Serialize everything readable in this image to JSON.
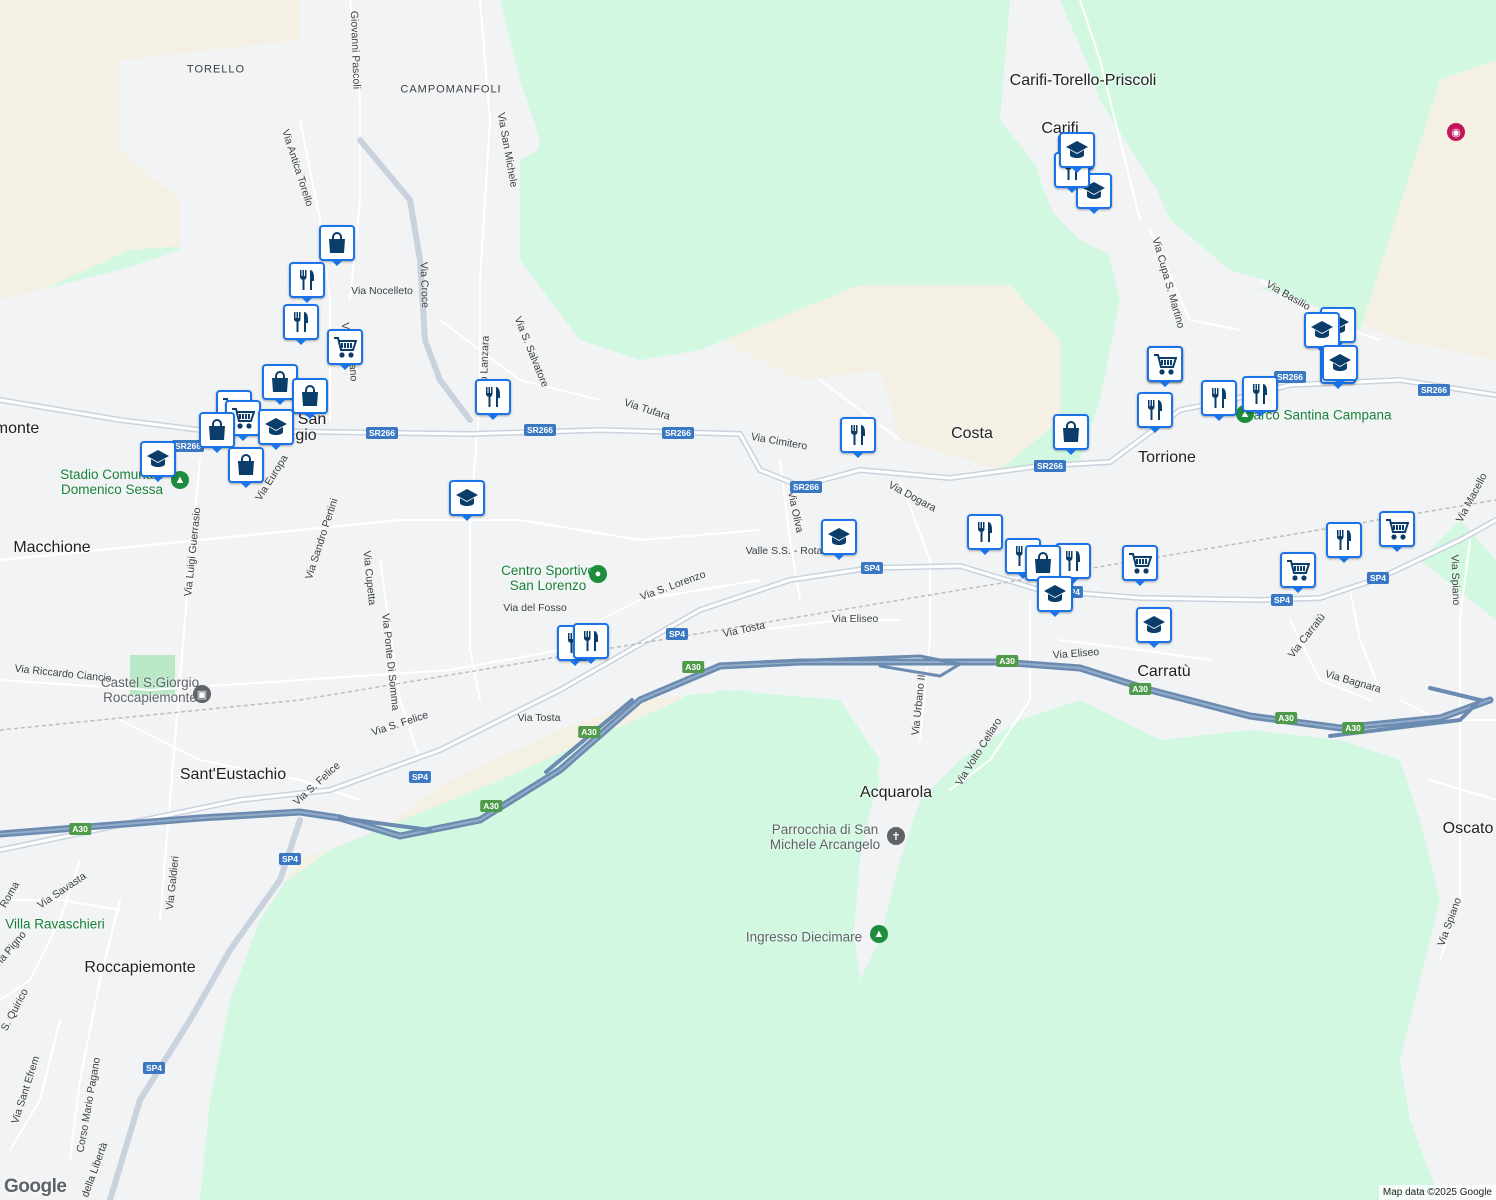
{
  "map": {
    "attribution": "Map data ©2025 Google",
    "brand": "Google",
    "places": [
      {
        "name": "TORELLO",
        "cls": "hamlet"
      },
      {
        "name": "CAMPOMANFOLI",
        "cls": "hamlet"
      },
      {
        "name": "Carifi-Torello-Priscoli",
        "cls": "place"
      },
      {
        "name": "Carifi",
        "cls": "place"
      },
      {
        "name": "Costa",
        "cls": "place"
      },
      {
        "name": "Torrione",
        "cls": "place"
      },
      {
        "name": "monte",
        "cls": "place"
      },
      {
        "name": "Macchione",
        "cls": "place"
      },
      {
        "name": "Carratù",
        "cls": "place"
      },
      {
        "name": "Acquarola",
        "cls": "place"
      },
      {
        "name": "Sant'Eustachio",
        "cls": "place"
      },
      {
        "name": "Oscato",
        "cls": "place"
      },
      {
        "name": "Roccapiemonte",
        "cls": "place"
      },
      {
        "name": "San",
        "cls": "place"
      },
      {
        "name": "gio",
        "cls": "place"
      }
    ],
    "streets": [
      "Giovanni Pascoli",
      "Via Antica Torello",
      "Via San Michele",
      "Via Croce",
      "Via Nocelleto",
      "Via S. Salvatore",
      "Via Tufara",
      "Via Cimitero",
      "Via Dogara",
      "Via Oliva",
      "Valle S.S. - Rota",
      "Via S. Lorenzo",
      "Via del Fosso",
      "Via Tosta",
      "Via Eliseo",
      "Via Eliseo",
      "Via Urbano II",
      "Via Volto Cellaro",
      "Via Cupa S. Martino",
      "Via Basilio",
      "Via Macello",
      "Via Spiano",
      "Via Carratù",
      "Via Bagnara",
      "Via Sandro Pertini",
      "Via Luigi Guerrasio",
      "Via Europa",
      "Via Cupetta",
      "Via Ponte Di Somma",
      "Via Riccardo Ciancio",
      "Via S. Felice",
      "Via Tosta",
      "Via S. Felice",
      "Via Galdieri",
      "Via Savasta",
      "Roma",
      "Via Pigno",
      "S. Quirico",
      "Via Sant Efrem",
      "Corso Mario Pagano",
      "della Libertà",
      "Via Spiano",
      "Capuano",
      "Via",
      "do Lanzara"
    ],
    "shields": [
      {
        "text": "SR266",
        "kind": "blue"
      },
      {
        "text": "SR266",
        "kind": "blue"
      },
      {
        "text": "SR266",
        "kind": "blue"
      },
      {
        "text": "SR266",
        "kind": "blue"
      },
      {
        "text": "SR266",
        "kind": "blue"
      },
      {
        "text": "SR266",
        "kind": "blue"
      },
      {
        "text": "SR266",
        "kind": "blue"
      },
      {
        "text": "SR266",
        "kind": "blue"
      },
      {
        "text": "SP4",
        "kind": "blue"
      },
      {
        "text": "SP4",
        "kind": "blue"
      },
      {
        "text": "SP4",
        "kind": "blue"
      },
      {
        "text": "SP4",
        "kind": "blue"
      },
      {
        "text": "SP4",
        "kind": "blue"
      },
      {
        "text": "SP4",
        "kind": "blue"
      },
      {
        "text": "SP4",
        "kind": "blue"
      },
      {
        "text": "SP4",
        "kind": "blue"
      },
      {
        "text": "A30",
        "kind": "green"
      },
      {
        "text": "A30",
        "kind": "green"
      },
      {
        "text": "A30",
        "kind": "green"
      },
      {
        "text": "A30",
        "kind": "green"
      },
      {
        "text": "A30",
        "kind": "green"
      },
      {
        "text": "A30",
        "kind": "green"
      },
      {
        "text": "A30",
        "kind": "green"
      },
      {
        "text": "A30",
        "kind": "green"
      }
    ],
    "pois": [
      {
        "name": "Stadio Comunale\nDomenico Sessa",
        "cls": "poi-green",
        "icon": "stadium-icon"
      },
      {
        "name": "Centro Sportivo\nSan Lorenzo",
        "cls": "poi-green",
        "icon": "sports-center-icon"
      },
      {
        "name": "Parco Santina Campana",
        "cls": "poi-green",
        "icon": "park-icon"
      },
      {
        "name": "Castel S.Giorgio\nRoccapiemonte",
        "cls": "poi-gray",
        "icon": "train-station-icon"
      },
      {
        "name": "Parrocchia di San\nMichele Arcangelo",
        "cls": "poi-gray",
        "icon": "church-icon"
      },
      {
        "name": "Ingresso Diecimare",
        "cls": "poi-gray",
        "icon": "nature-reserve-icon"
      },
      {
        "name": "Villa Ravaschieri",
        "cls": "poi-green",
        "icon": "villa-icon"
      }
    ],
    "markers": [
      {
        "type": "shopping"
      },
      {
        "type": "restaurant"
      },
      {
        "type": "restaurant"
      },
      {
        "type": "grocery"
      },
      {
        "type": "shopping"
      },
      {
        "type": "grocery"
      },
      {
        "type": "shopping"
      },
      {
        "type": "grocery"
      },
      {
        "type": "shopping"
      },
      {
        "type": "school"
      },
      {
        "type": "school"
      },
      {
        "type": "shopping"
      },
      {
        "type": "restaurant"
      },
      {
        "type": "school"
      },
      {
        "type": "restaurant"
      },
      {
        "type": "shopping"
      },
      {
        "type": "restaurant"
      },
      {
        "type": "school"
      },
      {
        "type": "school"
      },
      {
        "type": "school"
      },
      {
        "type": "restaurant"
      },
      {
        "type": "restaurant"
      },
      {
        "type": "shopping"
      },
      {
        "type": "school"
      },
      {
        "type": "restaurant"
      },
      {
        "type": "grocery"
      },
      {
        "type": "school"
      },
      {
        "type": "restaurant"
      },
      {
        "type": "grocery"
      },
      {
        "type": "restaurant"
      },
      {
        "type": "grocery"
      },
      {
        "type": "shopping"
      },
      {
        "type": "restaurant"
      },
      {
        "type": "school"
      },
      {
        "type": "school"
      },
      {
        "type": "school"
      },
      {
        "type": "grocery"
      },
      {
        "type": "restaurant"
      },
      {
        "type": "restaurant"
      },
      {
        "type": "restaurant"
      },
      {
        "type": "school"
      },
      {
        "type": "school"
      }
    ],
    "colors": {
      "forest": "#d3f8e2",
      "urban": "#f1f3f4",
      "sand": "#f5f0e1",
      "road": "#ffffff",
      "main_road": "#c9d3de",
      "highway": "#6b8bb0",
      "marker_border": "#1a73e8",
      "marker_icon": "#0b3d6b",
      "poi_green": "#188038"
    }
  }
}
